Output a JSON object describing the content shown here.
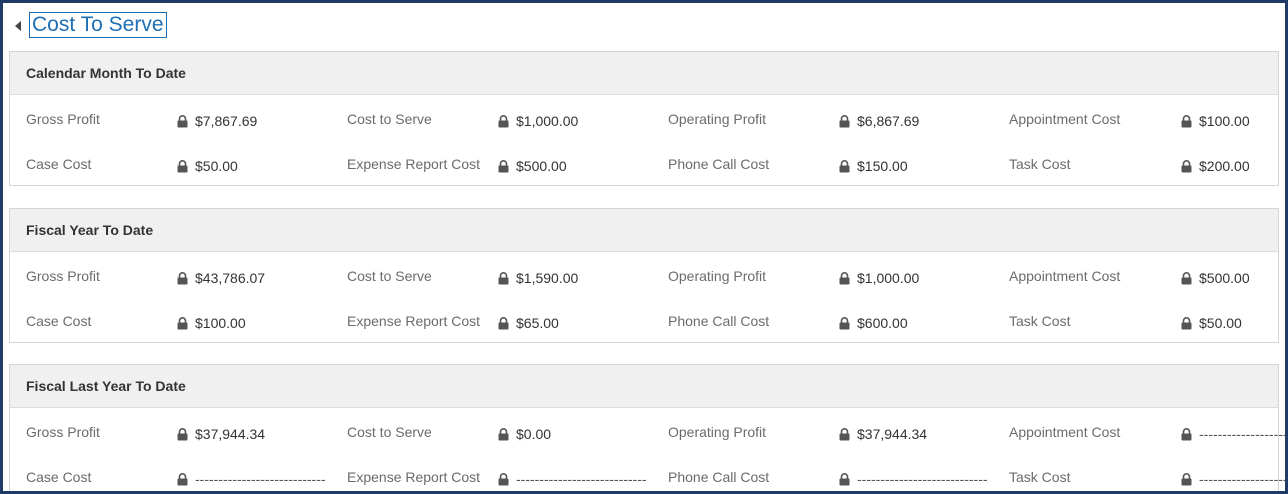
{
  "section": {
    "title": "Cost To Serve"
  },
  "groups": [
    {
      "title": "Calendar Month To Date",
      "rows": [
        [
          {
            "label": "Gross Profit",
            "value": "$7,867.69"
          },
          {
            "label": "Cost to Serve",
            "value": "$1,000.00"
          },
          {
            "label": "Operating Profit",
            "value": "$6,867.69"
          },
          {
            "label": "Appointment Cost",
            "value": "$100.00"
          }
        ],
        [
          {
            "label": "Case Cost",
            "value": "$50.00"
          },
          {
            "label": "Expense Report Cost",
            "value": "$500.00"
          },
          {
            "label": "Phone Call Cost",
            "value": "$150.00"
          },
          {
            "label": "Task Cost",
            "value": "$200.00"
          }
        ]
      ]
    },
    {
      "title": "Fiscal Year To Date",
      "rows": [
        [
          {
            "label": "Gross Profit",
            "value": "$43,786.07"
          },
          {
            "label": "Cost to Serve",
            "value": "$1,590.00"
          },
          {
            "label": "Operating Profit",
            "value": "$1,000.00"
          },
          {
            "label": "Appointment Cost",
            "value": "$500.00"
          }
        ],
        [
          {
            "label": "Case Cost",
            "value": "$100.00"
          },
          {
            "label": "Expense Report Cost",
            "value": "$65.00"
          },
          {
            "label": "Phone Call Cost",
            "value": "$600.00"
          },
          {
            "label": "Task Cost",
            "value": "$50.00"
          }
        ]
      ]
    },
    {
      "title": "Fiscal Last Year To Date",
      "rows": [
        [
          {
            "label": "Gross Profit",
            "value": "$37,944.34"
          },
          {
            "label": "Cost to Serve",
            "value": "$0.00"
          },
          {
            "label": "Operating Profit",
            "value": "$37,944.34"
          },
          {
            "label": "Appointment Cost",
            "value": "----------------------------"
          }
        ],
        [
          {
            "label": "Case Cost",
            "value": "----------------------------"
          },
          {
            "label": "Expense Report Cost",
            "value": "----------------------------"
          },
          {
            "label": "Phone Call Cost",
            "value": "----------------------------"
          },
          {
            "label": "Task Cost",
            "value": "----------------------------"
          }
        ]
      ]
    }
  ],
  "icons": {
    "field_lock": "lock-icon",
    "collapse": "collapse-arrow-icon"
  },
  "colors": {
    "accent": "#1e6fb5",
    "frame": "#1f3b66",
    "group_header_bg": "#f0f0f0"
  }
}
